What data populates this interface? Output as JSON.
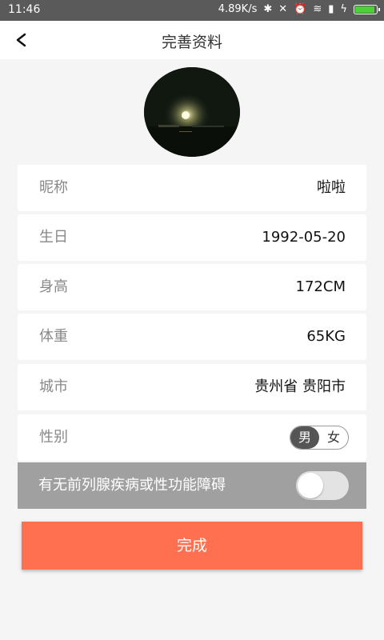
{
  "statusbar": {
    "time": "11:46",
    "speed": "4.89K/s"
  },
  "header": {
    "title": "完善资料",
    "back_icon": "back-arrow-icon"
  },
  "profile": {
    "rows": [
      {
        "label": "昵称",
        "value": "啦啦"
      },
      {
        "label": "生日",
        "value": "1992-05-20"
      },
      {
        "label": "身高",
        "value": "172CM"
      },
      {
        "label": "体重",
        "value": "65KG"
      },
      {
        "label": "城市",
        "value": "贵州省 贵阳市"
      }
    ],
    "gender": {
      "label": "性别",
      "male": "男",
      "female": "女",
      "selected": "男"
    },
    "question": {
      "label": "有无前列腺疾病或性功能障碍",
      "enabled": false
    }
  },
  "actions": {
    "done_label": "完成"
  },
  "colors": {
    "accent": "#ff7050",
    "question_bg": "#a0a0a0",
    "statusbar": "#5a5a5a"
  }
}
